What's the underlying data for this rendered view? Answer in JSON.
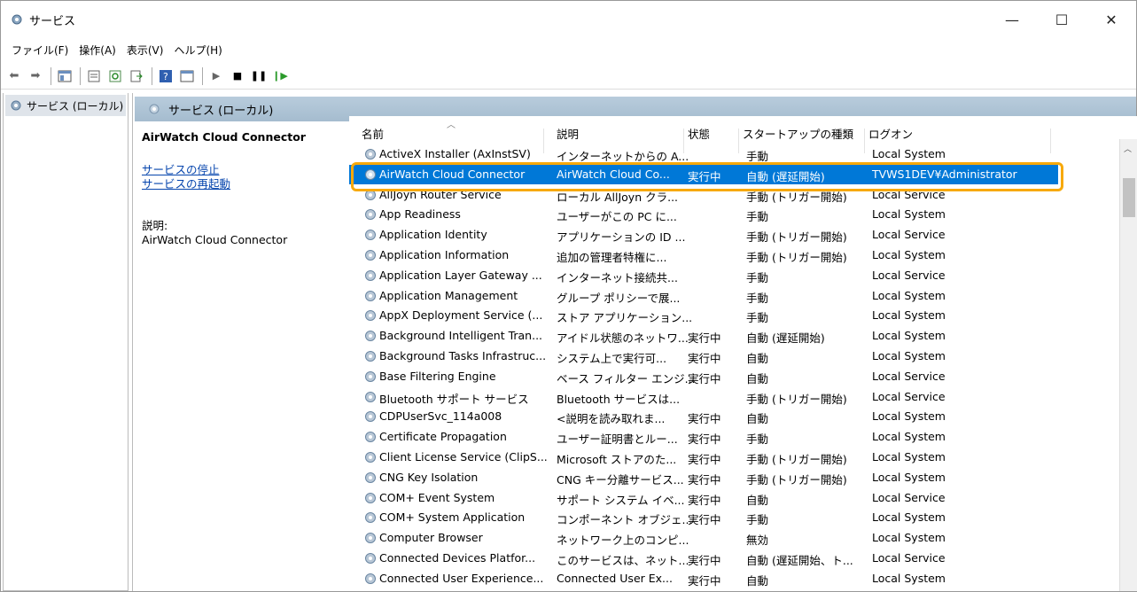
{
  "window": {
    "title": "サービス",
    "min": "—",
    "max": "☐",
    "close": "✕"
  },
  "menu": [
    "ファイル(F)",
    "操作(A)",
    "表示(V)",
    "ヘルプ(H)"
  ],
  "tree": {
    "root": "サービス (ローカル)"
  },
  "panel": {
    "header": "サービス (ローカル)",
    "service_name": "AirWatch Cloud Connector",
    "stop_link": "サービスの停止",
    "restart_link": "サービスの再起動",
    "desc_label": "説明:",
    "desc_text": "AirWatch Cloud Connector"
  },
  "columns": {
    "name": "名前",
    "desc": "説明",
    "status": "状態",
    "startup": "スタートアップの種類",
    "logon": "ログオン"
  },
  "rows": [
    {
      "name": "ActiveX Installer (AxInstSV)",
      "desc": "インターネットからの A...",
      "status": "",
      "startup": "手動",
      "logon": "Local System"
    },
    {
      "name": "AirWatch Cloud Connector",
      "desc": "AirWatch Cloud Co...",
      "status": "実行中",
      "startup": "自動 (遅延開始)",
      "logon": "TVWS1DEV¥Administrator"
    },
    {
      "name": "AllJoyn Router Service",
      "desc": "ローカル AllJoyn クラ...",
      "status": "",
      "startup": "手動 (トリガー開始)",
      "logon": "Local Service"
    },
    {
      "name": "App Readiness",
      "desc": "ユーザーがこの PC に...",
      "status": "",
      "startup": "手動",
      "logon": "Local System"
    },
    {
      "name": "Application Identity",
      "desc": "アプリケーションの ID ...",
      "status": "",
      "startup": "手動 (トリガー開始)",
      "logon": "Local Service"
    },
    {
      "name": "Application Information",
      "desc": "追加の管理者特権に...",
      "status": "",
      "startup": "手動 (トリガー開始)",
      "logon": "Local System"
    },
    {
      "name": "Application Layer Gateway ...",
      "desc": "インターネット接続共...",
      "status": "",
      "startup": "手動",
      "logon": "Local Service"
    },
    {
      "name": "Application Management",
      "desc": "グループ ポリシーで展...",
      "status": "",
      "startup": "手動",
      "logon": "Local System"
    },
    {
      "name": "AppX Deployment Service (...",
      "desc": "ストア アプリケーション...",
      "status": "",
      "startup": "手動",
      "logon": "Local System"
    },
    {
      "name": "Background Intelligent Tran...",
      "desc": "アイドル状態のネットワ...",
      "status": "実行中",
      "startup": "自動 (遅延開始)",
      "logon": "Local System"
    },
    {
      "name": "Background Tasks Infrastruc...",
      "desc": "システム上で実行可...",
      "status": "実行中",
      "startup": "自動",
      "logon": "Local System"
    },
    {
      "name": "Base Filtering Engine",
      "desc": "ベース フィルター エンジ...",
      "status": "実行中",
      "startup": "自動",
      "logon": "Local Service"
    },
    {
      "name": "Bluetooth サポート サービス",
      "desc": "Bluetooth サービスは...",
      "status": "",
      "startup": "手動 (トリガー開始)",
      "logon": "Local Service"
    },
    {
      "name": "CDPUserSvc_114a008",
      "desc": "<説明を読み取れま...",
      "status": "実行中",
      "startup": "自動",
      "logon": "Local System"
    },
    {
      "name": "Certificate Propagation",
      "desc": "ユーザー証明書とルー...",
      "status": "実行中",
      "startup": "手動",
      "logon": "Local System"
    },
    {
      "name": "Client License Service (ClipS...",
      "desc": "Microsoft ストアのた...",
      "status": "実行中",
      "startup": "手動 (トリガー開始)",
      "logon": "Local System"
    },
    {
      "name": "CNG Key Isolation",
      "desc": "CNG キー分離サービス...",
      "status": "実行中",
      "startup": "手動 (トリガー開始)",
      "logon": "Local System"
    },
    {
      "name": "COM+ Event System",
      "desc": "サポート システム イベ...",
      "status": "実行中",
      "startup": "自動",
      "logon": "Local Service"
    },
    {
      "name": "COM+ System Application",
      "desc": "コンポーネント オブジェ...",
      "status": "実行中",
      "startup": "手動",
      "logon": "Local System"
    },
    {
      "name": "Computer Browser",
      "desc": "ネットワーク上のコンピ...",
      "status": "",
      "startup": "無効",
      "logon": "Local System"
    },
    {
      "name": "Connected Devices Platfor...",
      "desc": "このサービスは、ネット...",
      "status": "実行中",
      "startup": "自動 (遅延開始、ト...",
      "logon": "Local Service"
    },
    {
      "name": "Connected User Experience...",
      "desc": "Connected User Ex...",
      "status": "実行中",
      "startup": "自動",
      "logon": "Local System"
    }
  ]
}
